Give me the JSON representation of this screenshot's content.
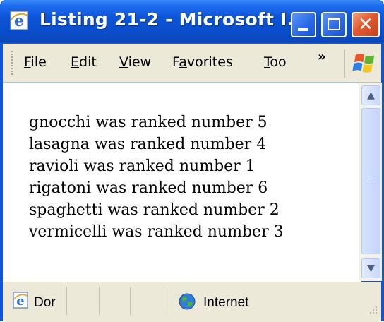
{
  "window": {
    "title": "Listing 21-2 - Microsoft I...",
    "close_glyph": "✕"
  },
  "menubar": {
    "items": [
      {
        "label": "File",
        "accel": "F",
        "rest": "ile"
      },
      {
        "label": "Edit",
        "accel": "E",
        "rest": "dit"
      },
      {
        "label": "View",
        "accel": "V",
        "rest": "iew"
      },
      {
        "label": "Favorites",
        "pre": "F",
        "accel": "a",
        "rest": "vorites"
      },
      {
        "label": "Too",
        "accel": "T",
        "rest": "oo"
      }
    ],
    "overflow_glyph": "»"
  },
  "content": {
    "lines": [
      "gnocchi was ranked number 5",
      "lasagna was ranked number 4",
      "ravioli was ranked number 1",
      "rigatoni was ranked number 6",
      "spaghetti was ranked number 2",
      "vermicelli was ranked number 3"
    ]
  },
  "scrollbar": {
    "up_glyph": "▲",
    "down_glyph": "▼"
  },
  "statusbar": {
    "status_text": "Dor",
    "zone_text": "Internet"
  },
  "icons": {
    "title": "ie-icon",
    "logo": "windows-flag-icon",
    "status_ie": "ie-page-icon",
    "zone": "globe-icon"
  }
}
